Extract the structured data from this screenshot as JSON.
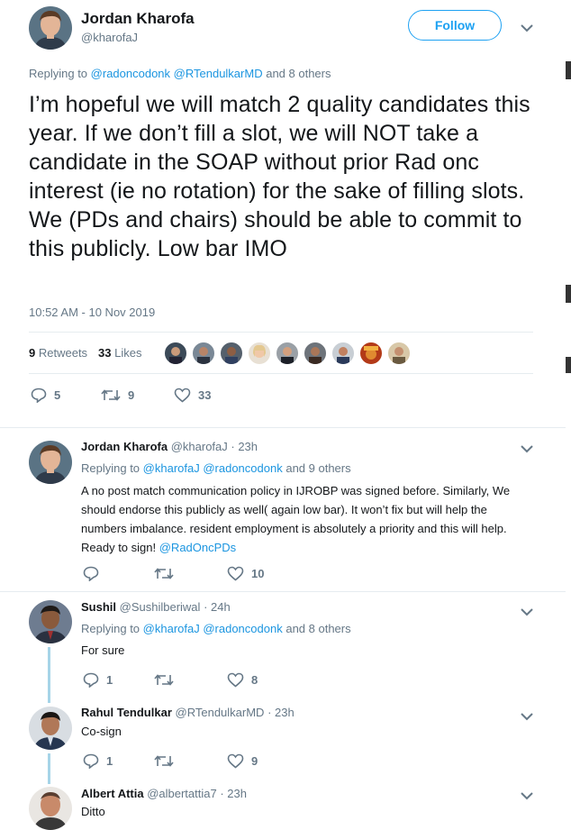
{
  "main_tweet": {
    "author_name": "Jordan Kharofa",
    "author_handle": "@kharofaJ",
    "follow_label": "Follow",
    "replying_prefix": "Replying to",
    "replying_users": "@radoncodonk @RTendulkarMD",
    "replying_suffix": "and 8 others",
    "text": "I’m hopeful we will match 2 quality candidates this year. If we don’t fill a slot, we will NOT take a candidate in the SOAP without prior Rad onc interest (ie no rotation) for the sake of filling slots. We (PDs and chairs) should be able to commit to this publicly. Low bar IMO",
    "timestamp": "10:52 AM - 10 Nov 2019",
    "retweets_count": "9",
    "retweets_label": "Retweets",
    "likes_count": "33",
    "likes_label": "Likes",
    "reply_count": "5",
    "retweet_action_count": "9",
    "like_action_count": "33"
  },
  "replies": [
    {
      "name": "Jordan Kharofa",
      "handle": "@kharofaJ",
      "time": "· 23h",
      "replying_prefix": "Replying to",
      "replying_users": "@kharofaJ @radoncodonk",
      "replying_suffix": "and 9 others",
      "text": "A no post match communication policy in IJROBP was signed before. Similarly, We should endorse this publicly as well( again low bar). It won’t fix but will help the numbers imbalance. resident employment is absolutely a priority and this will help. Ready to sign!",
      "text_link": "@RadOncPDs",
      "reply_count": "",
      "retweet_count": "",
      "like_count": "10"
    },
    {
      "name": "Sushil",
      "handle": "@Sushilberiwal",
      "time": "· 24h",
      "replying_prefix": "Replying to",
      "replying_users": "@kharofaJ @radoncodonk",
      "replying_suffix": "and 8 others",
      "text": "For sure",
      "reply_count": "1",
      "retweet_count": "",
      "like_count": "8"
    },
    {
      "name": "Rahul Tendulkar",
      "handle": "@RTendulkarMD",
      "time": "· 23h",
      "text": "Co-sign",
      "reply_count": "1",
      "retweet_count": "",
      "like_count": "9"
    },
    {
      "name": "Albert Attia",
      "handle": "@albertattia7",
      "time": "· 23h",
      "text": "Ditto"
    }
  ],
  "colors": {
    "accent": "#1da1f2",
    "link": "#1b95e0",
    "muted": "#657786",
    "thread": "#a6d4e8"
  },
  "icons": [
    "reply-icon",
    "retweet-icon",
    "heart-icon",
    "chevron-down-icon"
  ]
}
